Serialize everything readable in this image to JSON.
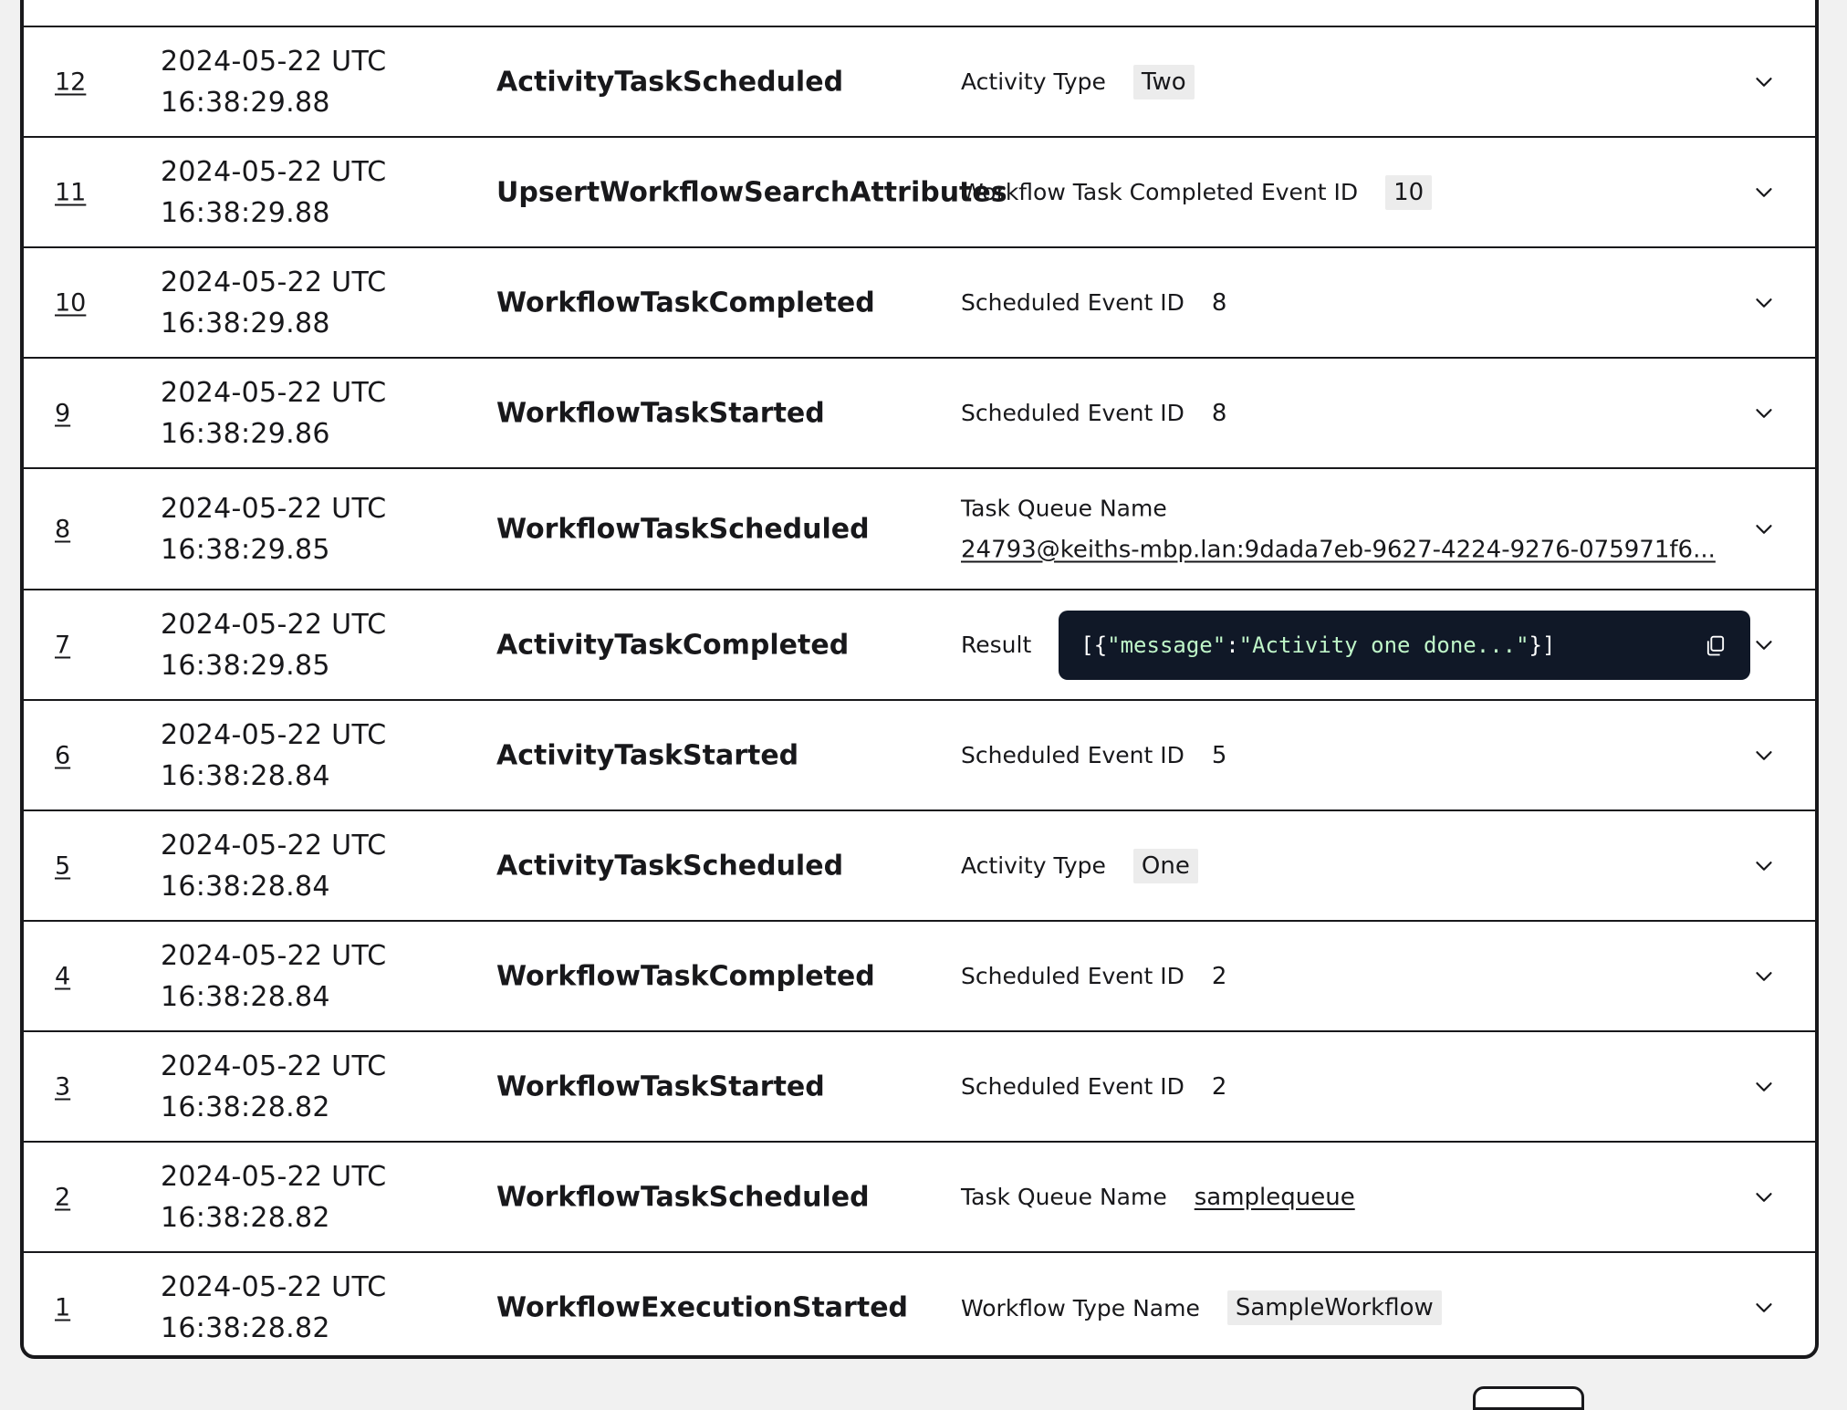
{
  "events": [
    {
      "id": "12",
      "date": "2024-05-22 UTC",
      "time": "16:38:29.88",
      "type": "ActivityTaskScheduled",
      "detail_label": "Activity Type",
      "detail_value": "Two",
      "style": "chip"
    },
    {
      "id": "11",
      "date": "2024-05-22 UTC",
      "time": "16:38:29.88",
      "type": "UpsertWorkflowSearchAttributes",
      "detail_label": "Workflow Task Completed Event ID",
      "detail_value": "10",
      "style": "chip"
    },
    {
      "id": "10",
      "date": "2024-05-22 UTC",
      "time": "16:38:29.88",
      "type": "WorkflowTaskCompleted",
      "detail_label": "Scheduled Event ID",
      "detail_value": "8",
      "style": "plain"
    },
    {
      "id": "9",
      "date": "2024-05-22 UTC",
      "time": "16:38:29.86",
      "type": "WorkflowTaskStarted",
      "detail_label": "Scheduled Event ID",
      "detail_value": "8",
      "style": "plain"
    },
    {
      "id": "8",
      "date": "2024-05-22 UTC",
      "time": "16:38:29.85",
      "type": "WorkflowTaskScheduled",
      "detail_label": "Task Queue Name",
      "detail_value": "24793@keiths-mbp.lan:9dada7eb-9627-4224-9276-075971f6...",
      "style": "link-stacked"
    },
    {
      "id": "7",
      "date": "2024-05-22 UTC",
      "time": "16:38:29.85",
      "type": "ActivityTaskCompleted",
      "detail_label": "Result",
      "detail_value": "[{\"message\":\"Activity one done...\"}]",
      "style": "code"
    },
    {
      "id": "6",
      "date": "2024-05-22 UTC",
      "time": "16:38:28.84",
      "type": "ActivityTaskStarted",
      "detail_label": "Scheduled Event ID",
      "detail_value": "5",
      "style": "plain"
    },
    {
      "id": "5",
      "date": "2024-05-22 UTC",
      "time": "16:38:28.84",
      "type": "ActivityTaskScheduled",
      "detail_label": "Activity Type",
      "detail_value": "One",
      "style": "chip"
    },
    {
      "id": "4",
      "date": "2024-05-22 UTC",
      "time": "16:38:28.84",
      "type": "WorkflowTaskCompleted",
      "detail_label": "Scheduled Event ID",
      "detail_value": "2",
      "style": "plain"
    },
    {
      "id": "3",
      "date": "2024-05-22 UTC",
      "time": "16:38:28.82",
      "type": "WorkflowTaskStarted",
      "detail_label": "Scheduled Event ID",
      "detail_value": "2",
      "style": "plain"
    },
    {
      "id": "2",
      "date": "2024-05-22 UTC",
      "time": "16:38:28.82",
      "type": "WorkflowTaskScheduled",
      "detail_label": "Task Queue Name",
      "detail_value": "samplequeue",
      "style": "link"
    },
    {
      "id": "1",
      "date": "2024-05-22 UTC",
      "time": "16:38:28.82",
      "type": "WorkflowExecutionStarted",
      "detail_label": "Workflow Type Name",
      "detail_value": "SampleWorkflow",
      "style": "chip"
    }
  ],
  "icons": {
    "expand": "chevron-down-icon",
    "copy": "copy-icon"
  },
  "colors": {
    "border": "#18181b",
    "chip_bg": "#ececec",
    "code_bg": "#101827",
    "code_string": "#bff5c8",
    "page_bg": "#f1f1f1"
  }
}
